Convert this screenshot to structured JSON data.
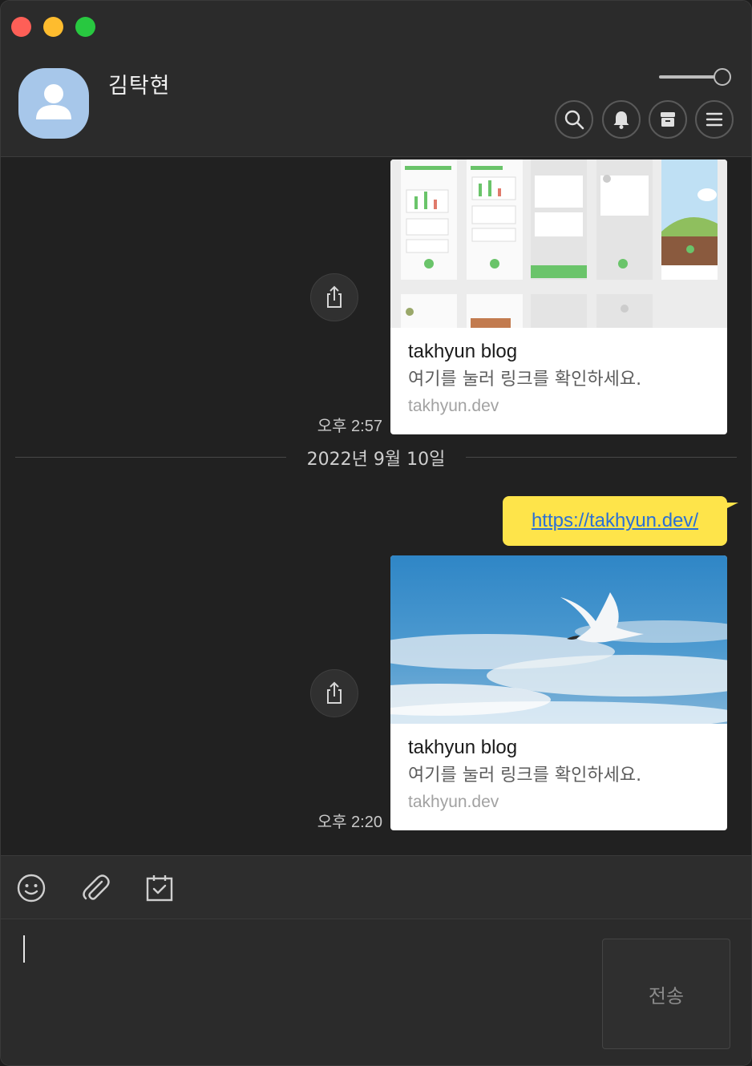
{
  "header": {
    "profile_name": "김탁현",
    "icons": [
      "search-icon",
      "bell-icon",
      "archive-icon",
      "menu-icon"
    ]
  },
  "messages": [
    {
      "type": "link-card",
      "title": "takhyun blog",
      "description": "여기를 눌러 링크를 확인하세요.",
      "domain": "takhyun.dev",
      "time": "오후 2:57"
    },
    {
      "type": "date-divider",
      "text": "2022년 9월 10일"
    },
    {
      "type": "text-bubble",
      "text": "https://takhyun.dev/"
    },
    {
      "type": "link-card",
      "title": "takhyun blog",
      "description": "여기를 눌러 링크를 확인하세요.",
      "domain": "takhyun.dev",
      "time": "오후 2:20"
    }
  ],
  "toolbar": {
    "icons": [
      "emoji-icon",
      "attachment-icon",
      "calendar-check-icon"
    ]
  },
  "composer": {
    "value": "",
    "send_label": "전송"
  },
  "colors": {
    "bubble": "#fee44a",
    "link": "#2a6fd6",
    "background": "#212121",
    "header": "#2b2b2b"
  }
}
